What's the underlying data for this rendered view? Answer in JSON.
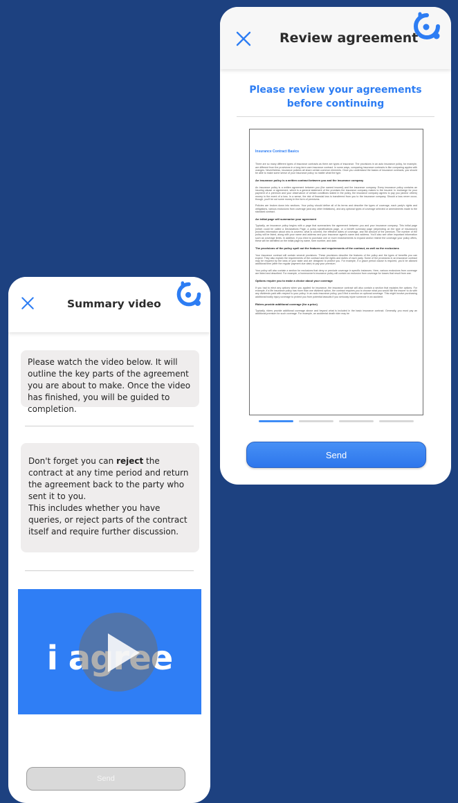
{
  "review_screen": {
    "title": "Review agreement",
    "heading": "Please review your agreements before continuing",
    "send_label": "Send",
    "pager": {
      "pages": 4,
      "active": 1
    },
    "document": {
      "title": "Insurance Contract Basics",
      "intro": "There are so many different types of insurance contracts as there are types of insurance. The provisions in an auto insurance policy, for example, are different from the provisions in a long-term care insurance contract. In some ways, comparing insurance contracts is like comparing apples with oranges. Nevertheless, insurance policies all share certain common elements. Once you understand the basics of insurance contracts, you should be able to make some sense of your insurance policy no matter what the type.",
      "sections": [
        {
          "heading": "An insurance policy is a written contract between you and the insurance company",
          "paras": [
            "An insurance policy is a written agreement between you (the named insured) and the insurance company. Every insurance policy contains an insuring clause or agreement, which is a general statement of the promises the insurance company makes to the insured. In exchange for your payment of a premium and your observance of certain conditions stated in the policy, the insurance company agrees to pay you (and/or others) money in the event of a loss. In a sense, the risk of financial loss is transferred from you to the insurance company. Should a loss never occur, though, you'll be out some money in the form of premiums.",
            "Policies are broken down into sections. Your policy should define all of its terms and describe the types of coverage, each party's rights and obligations, various exclusions from coverage (and any other limitations), and any optional types of coverage selected or amendments made to the standard contract."
          ]
        },
        {
          "heading": "An initial page will summarize your agreement",
          "paras": [
            "Typically, an insurance policy begins with a page that summarizes the agreement between you and your insurance company. This initial page (which could be called a Declarations Page, a policy specifications page, or a benefit summary page (depending on the type of insurance)) provides information about who is covered, what is covered, the effective dates of coverage, and the amount of the premium. The number of the policy will be listed, along with your name and address and your insurance agent's name and address. You'll also see other important information such as coverage limits. In addition, if you elect to purchase one or more endorsements to expand and/or restrict the coverage your policy offers, these will be identified on the initial page by name, form number, and date."
          ]
        },
        {
          "heading": "The provisions of the policy spell out the features and requirements of the contract, as well as the exclusions",
          "paras": [
            "Your insurance contract will contain several provisions. These provisions describe the features of the policy and the types of benefits you can expect. They also explain the requirements of the contract and the rights and duties of each party. Some of the provisions in an insurance contract may be required by the laws of your state and are designed to protect you. For example, if a grace period clause is required, you'd be allowed additional time (after the regular payment due date) to pay your premium.",
            "Your policy will also contain a section for exclusions that deny or preclude coverage in specific instances. Here, various exclusions from coverage are listed and described. For example, a homeowner's insurance policy will contain an exclusion from coverage for losses that result from war."
          ]
        },
        {
          "heading": "Options require you to make a choice about your coverage",
          "paras": [
            "If you had to elect any options when you applied for insurance, the insurance contract will also contain a section that explains the options. For example, if a life insurance policy has more than one dividend option, the contract requires you to choose what you would like the insurer to do with any dividends paid with respect to your policy. In an auto insurance policy, you'll find a section on optional coverage. This might involve purchasing additional bodily injury coverage to protect you from potential lawsuits if you seriously injure someone in an accident."
          ]
        },
        {
          "heading": "Riders provide additional coverage (for a price)",
          "paras": [
            "Typically, riders provide additional coverage above and beyond what is included in the basic insurance contract. Generally, you must pay an additional premium for such coverage. For example, an accidental death rider may be"
          ]
        }
      ]
    }
  },
  "summary_screen": {
    "title": "Summary video",
    "intro_text": "Please watch the video below. It will outline the key parts of the agreement you are about to make.  Once the video has finished, you will be guided to completion.",
    "reminder_before": "Don't forget you can ",
    "reminder_bold": "reject",
    "reminder_after": " the contract at any time period and return the agreement back to the party who sent it to you.",
    "reminder_second": "This includes whether you have queries, or reject parts of the contract itself and require further discussion.",
    "video_brand": "i agree",
    "send_label": "Send"
  },
  "colors": {
    "background": "#1d4180",
    "accent": "#2d7df3",
    "video_bg": "#2f7ef5"
  },
  "icons": [
    "close-icon",
    "brand-logo-icon",
    "play-icon"
  ]
}
